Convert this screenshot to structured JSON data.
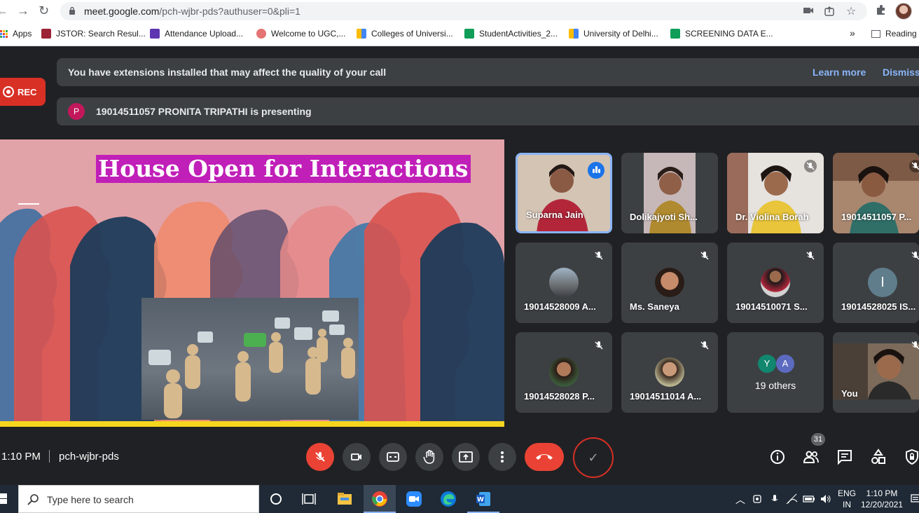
{
  "browser": {
    "url_host": "meet.google.com",
    "url_path": "/pch-wjbr-pds?authuser=0&pli=1",
    "bookmarks": [
      {
        "label": "Apps",
        "color": "#4285f4"
      },
      {
        "label": "JSTOR: Search Resul...",
        "color": "#9b2335"
      },
      {
        "label": "Attendance Upload...",
        "color": "#5e35b1"
      },
      {
        "label": "Welcome to UGC,...",
        "color": "#e57373"
      },
      {
        "label": "Colleges of Universi...",
        "color": "#fbbc04"
      },
      {
        "label": "StudentActivities_2...",
        "color": "#0f9d58"
      },
      {
        "label": "University of Delhi...",
        "color": "#fbbc04"
      },
      {
        "label": "SCREENING DATA E...",
        "color": "#0f9d58"
      }
    ],
    "more_bookmarks": "»",
    "reading_list": "Reading"
  },
  "meet": {
    "rec_label": "REC",
    "extension_banner": "You have extensions installed that may affect the quality of your call",
    "learn_more": "Learn more",
    "dismiss": "Dismiss",
    "presenter_initial": "P",
    "presenting_text": "19014511057 PRONITA TRIPATHI is presenting",
    "slide_title": "House Open for Interactions",
    "participants": [
      {
        "name": "Suparna Jain",
        "speaking": true
      },
      {
        "name": "Dolikajyoti Sh..."
      },
      {
        "name": "Dr. Violina Borah"
      },
      {
        "name": "19014511057 P..."
      },
      {
        "name": "19014528009 A..."
      },
      {
        "name": "Ms. Saneya"
      },
      {
        "name": "19014510071 S..."
      },
      {
        "name": "19014528025 IS...",
        "initial": "I"
      },
      {
        "name": "19014528028 P..."
      },
      {
        "name": "19014511014 A..."
      },
      {
        "name": "19 others",
        "initials": [
          "Y",
          "A"
        ]
      },
      {
        "name": "You"
      }
    ],
    "time": "1:10 PM",
    "meeting_code": "pch-wjbr-pds",
    "people_count": "31"
  },
  "taskbar": {
    "search_placeholder": "Type here to search",
    "lang_top": "ENG",
    "lang_bottom": "IN",
    "clock_time": "1:10 PM",
    "clock_date": "12/20/2021"
  }
}
